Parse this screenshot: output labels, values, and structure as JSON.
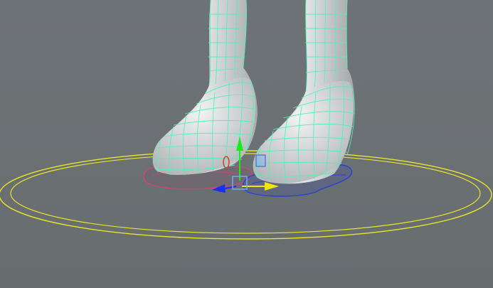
{
  "app": {
    "view_type": "3d-modeling-viewport-perspective",
    "selection": "shoe-mesh-pair"
  },
  "colors": {
    "background": "#6c7174",
    "mesh_wire": "#4cf2b8",
    "ground_ring": "#e9e52a",
    "curve_red": "#c84a73",
    "curve_blue": "#2a3fd8",
    "gizmo_y": "#1ee81e",
    "gizmo_x": "#f0e40a",
    "gizmo_z": "#1a2ef0",
    "gizmo_rotate": "#e23a3a",
    "gizmo_handle": "#6db3ff"
  },
  "icons": {
    "move_gizmo": "move-manipulator-icon",
    "y_axis_arrow": "arrow-up-icon",
    "x_axis_arrow": "arrow-right-icon",
    "z_axis_arrow": "arrow-left-icon",
    "center_handle": "square-handle-icon"
  }
}
